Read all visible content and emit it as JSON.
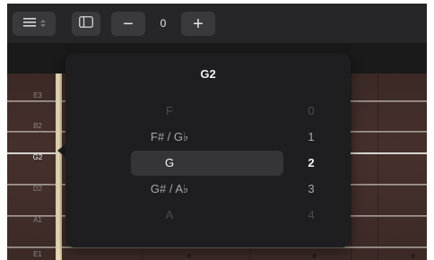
{
  "toolbar": {
    "menu_icon": "list-icon",
    "menu_chevron_icon": "up-down-chevron-icon",
    "sidebar_icon": "sidebar-icon",
    "minus_symbol": "−",
    "plus_symbol": "+",
    "stepper_value": "0"
  },
  "strings": [
    {
      "label": "E3"
    },
    {
      "label": "B2"
    },
    {
      "label": "G2"
    },
    {
      "label": "D2"
    },
    {
      "label": "A1"
    },
    {
      "label": "E1"
    }
  ],
  "selected_string": "G2",
  "popup": {
    "title": "G2",
    "options": [
      {
        "note": "F",
        "value": "0"
      },
      {
        "note": "F# / G♭",
        "value": "1"
      },
      {
        "note": "G",
        "value": "2"
      },
      {
        "note": "G# / A♭",
        "value": "3"
      },
      {
        "note": "A",
        "value": "4"
      }
    ],
    "selected_index": 2
  },
  "colors": {
    "background": "#1c1c1e",
    "toolbar": "#262628",
    "fretboard": "#46302c",
    "popup": "#1e1e20",
    "highlight": "#353537"
  }
}
